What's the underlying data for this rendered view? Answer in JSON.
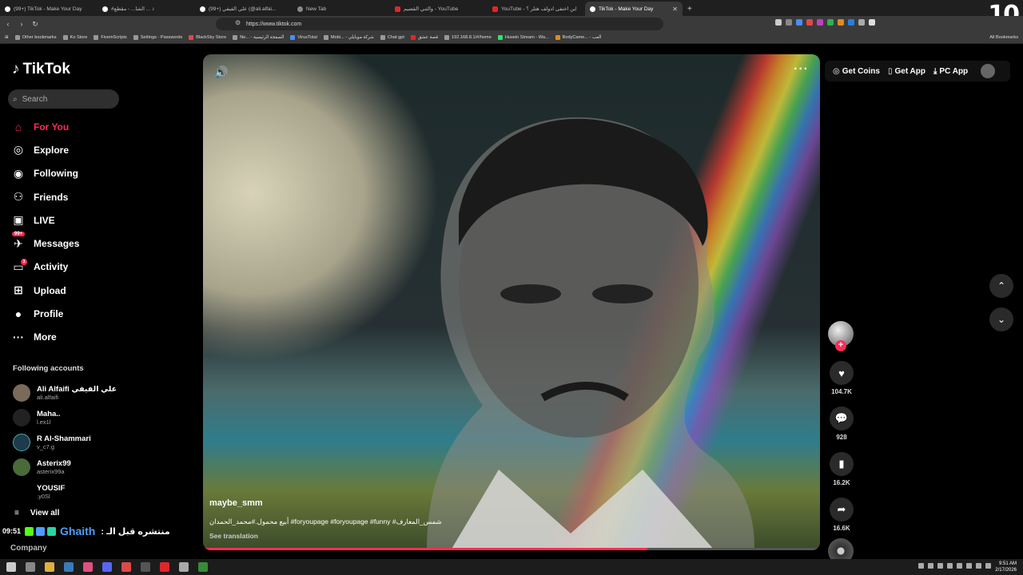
{
  "browser": {
    "tabs": [
      {
        "label": "(99+) TikTok - Make Your Day",
        "favicon": "tiktok"
      },
      {
        "label": "#الشا... - مقطع ... ♪",
        "favicon": "tiktok"
      },
      {
        "label": "(99+) علي الفيفي (@ali.alfai...",
        "favicon": "tiktok"
      },
      {
        "label": "New Tab",
        "favicon": "chrome"
      },
      {
        "label": "والثني القصيم - YouTube",
        "favicon": "youtube"
      },
      {
        "label": "YouTube - اين اختفى ادولف هتلر ؟",
        "favicon": "youtube"
      },
      {
        "label": "TikTok - Make Your Day",
        "favicon": "tiktok",
        "active": true
      }
    ],
    "overlay_number": "10",
    "url": "https://www.tiktok.com",
    "bookmarks": [
      "Other bookmarks",
      "Ko Store",
      "FivemScripts",
      "Settings - Passwords",
      "BlackSky Store",
      "Ne... - الصفحة الرئيسية",
      "VirusTotal",
      "Mobi... - شركة موبايلي",
      "Chat gpt",
      "قصة عشق",
      "192.168.8.1/#/home",
      "Husein Stream - Wa...",
      "BodyCame... - العب"
    ],
    "all_bookmarks": "All Bookmarks"
  },
  "tiktok": {
    "brand": "TikTok",
    "search_placeholder": "Search",
    "nav": [
      {
        "label": "For You",
        "icon": "home-icon",
        "active": true
      },
      {
        "label": "Explore",
        "icon": "compass-icon"
      },
      {
        "label": "Following",
        "icon": "following-icon"
      },
      {
        "label": "Friends",
        "icon": "friends-icon"
      },
      {
        "label": "LIVE",
        "icon": "live-icon"
      },
      {
        "label": "Messages",
        "icon": "messages-icon",
        "badge": "99+"
      },
      {
        "label": "Activity",
        "icon": "activity-icon",
        "badge": "3"
      },
      {
        "label": "Upload",
        "icon": "upload-icon"
      },
      {
        "label": "Profile",
        "icon": "profile-icon"
      },
      {
        "label": "More",
        "icon": "more-icon"
      }
    ],
    "following_title": "Following accounts",
    "accounts": [
      {
        "name": "Ali Alfaifi علي الفيفي",
        "handle": "ali.alfaifi"
      },
      {
        "name": "Maha..",
        "handle": "l.ex1l"
      },
      {
        "name": "R Al-Shammari",
        "handle": "v_c7.g"
      },
      {
        "name": "Asterix99",
        "handle": "asterix99a"
      },
      {
        "name": "YOUSIF",
        "handle": ".y0Sl"
      }
    ],
    "view_all": "View all",
    "company": "Company",
    "header": {
      "get_coins": "Get Coins",
      "get_app": "Get App",
      "pc_app": "PC App"
    },
    "video": {
      "username": "maybe_smm",
      "caption": "أبيع محمول.#محمد_الحمدان #foryoupage #foryoupage #funny #شمس_المعارف",
      "see_translation": "See translation",
      "progress_percent": 72
    },
    "stats": {
      "likes": "104.7K",
      "comments": "928",
      "saves": "16.2K",
      "shares": "16.6K"
    }
  },
  "stream_overlay": {
    "time": "09:51",
    "name": "Ghaith",
    "text": "منتشره قبل الـ :"
  },
  "taskbar": {
    "time": "9:51 AM",
    "date": "2/17/2026"
  },
  "colors": {
    "accent": "#fe2c55",
    "stream_name": "#4d9eff"
  }
}
